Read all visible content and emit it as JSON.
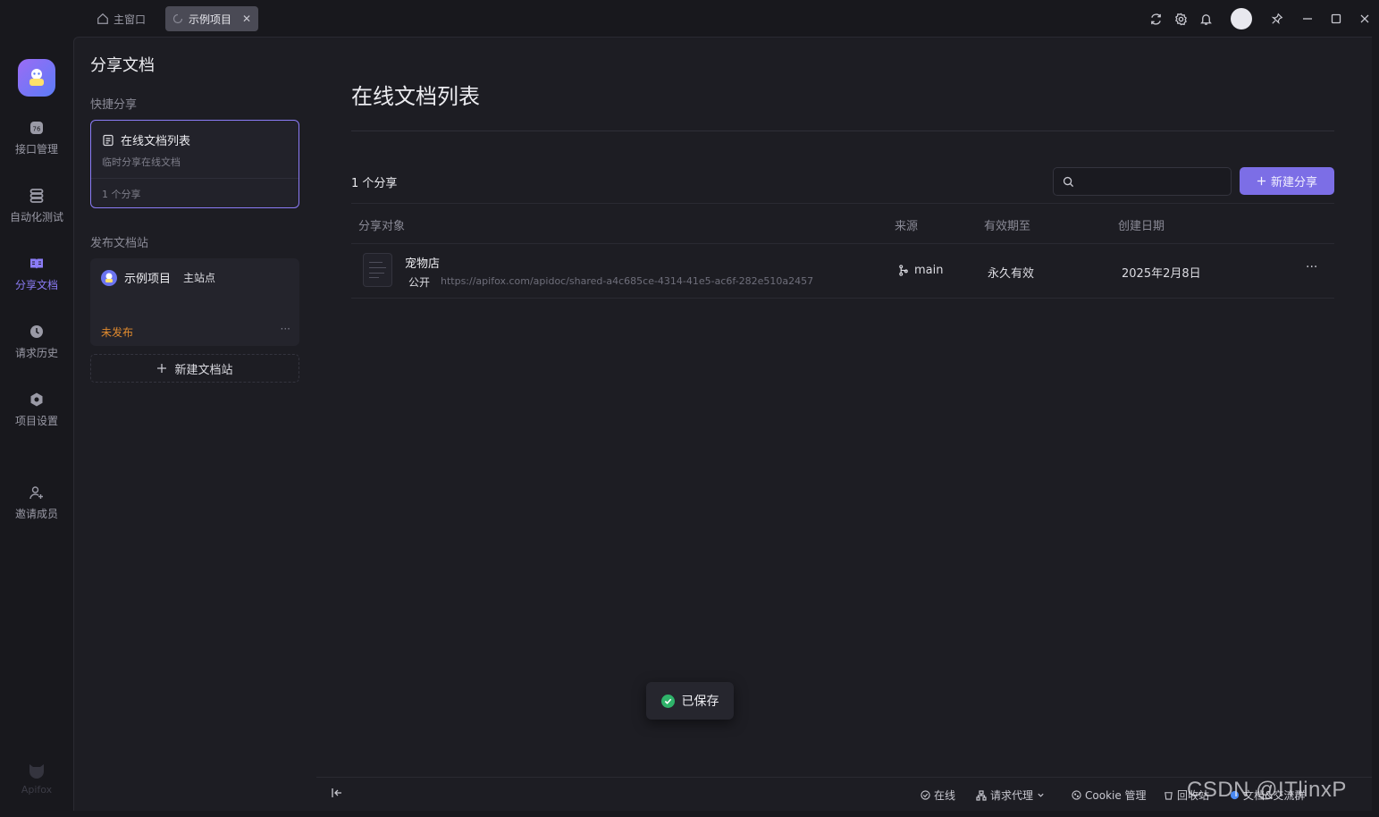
{
  "titlebar": {
    "home_tab": "主窗口",
    "active_tab": "示例项目",
    "close_glyph": "✕",
    "window_controls": [
      "refresh-icon",
      "gear-icon",
      "bell-icon",
      "avatar",
      "pin-icon",
      "minimize-icon",
      "maximize-icon",
      "close-icon"
    ]
  },
  "rail": {
    "items": [
      {
        "label": "接口管理",
        "icon": "api-icon"
      },
      {
        "label": "自动化测试",
        "icon": "automation-icon"
      },
      {
        "label": "分享文档",
        "icon": "book-icon",
        "active": true
      },
      {
        "label": "请求历史",
        "icon": "clock-icon"
      },
      {
        "label": "项目设置",
        "icon": "gear-icon"
      },
      {
        "label": "邀请成员",
        "icon": "add-user-icon"
      }
    ],
    "footer_brand": "Apifox"
  },
  "sidebar": {
    "title": "分享文档",
    "quick_share_label": "快捷分享",
    "quick_card": {
      "title": "在线文档列表",
      "subtitle": "临时分享在线文档",
      "count": "1 个分享"
    },
    "publish_label": "发布文档站",
    "site_card": {
      "project": "示例项目",
      "site": "主站点",
      "status": "未发布",
      "more": "···"
    },
    "new_site_label": "新建文档站"
  },
  "main": {
    "title": "在线文档列表",
    "count": "1 个分享",
    "search_placeholder": "",
    "new_share_label": "新建分享",
    "columns": [
      "分享对象",
      "来源",
      "有效期至",
      "创建日期"
    ],
    "rows": [
      {
        "name": "宠物店",
        "visibility": "公开",
        "url": "https://apifox.com/apidoc/shared-a4c685ce-4314-41e5-ac6f-282e510a2457",
        "source": "main",
        "expires": "永久有效",
        "created": "2025年2月8日",
        "more": "···"
      }
    ]
  },
  "toast": {
    "text": "已保存"
  },
  "statusbar": {
    "online": "在线",
    "proxy": "请求代理",
    "cookie": "Cookie 管理",
    "recycle": "回收站",
    "docs": "文档&交流群"
  },
  "watermark": "CSDN @ITlinxP",
  "colors": {
    "accent": "#7c6ee6",
    "accent_light": "#8b7cf6",
    "warning": "#e08a2e",
    "success": "#2fb36a",
    "background": "#18181d",
    "panel": "#1d1d23"
  }
}
